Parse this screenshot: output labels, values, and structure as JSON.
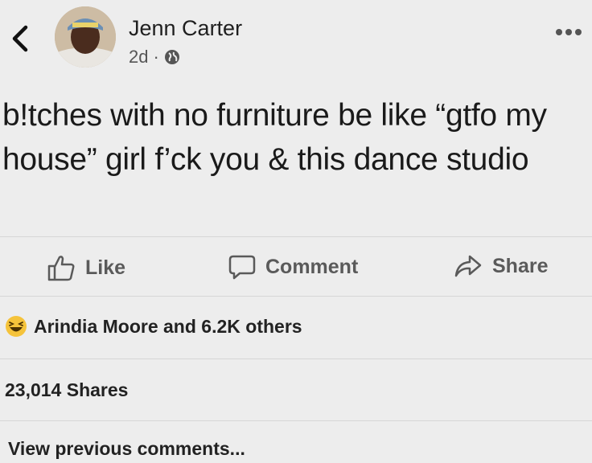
{
  "post": {
    "author": "Jenn Carter",
    "time": "2d",
    "separator": "·",
    "text": "b!tches with no furniture be like “gtfo my house” girl f’ck you & this dance studio"
  },
  "actions": {
    "like": "Like",
    "comment": "Comment",
    "share": "Share"
  },
  "reactions": {
    "summary": "Arindia Moore and 6.2K others"
  },
  "shares": "23,014 Shares",
  "comments": {
    "view_previous": "View previous comments..."
  },
  "icons": [
    "back-chevron-icon",
    "globe-icon",
    "more-dots-icon",
    "thumbs-up-icon",
    "speech-bubble-icon",
    "share-arrow-icon",
    "haha-emoji-icon"
  ]
}
